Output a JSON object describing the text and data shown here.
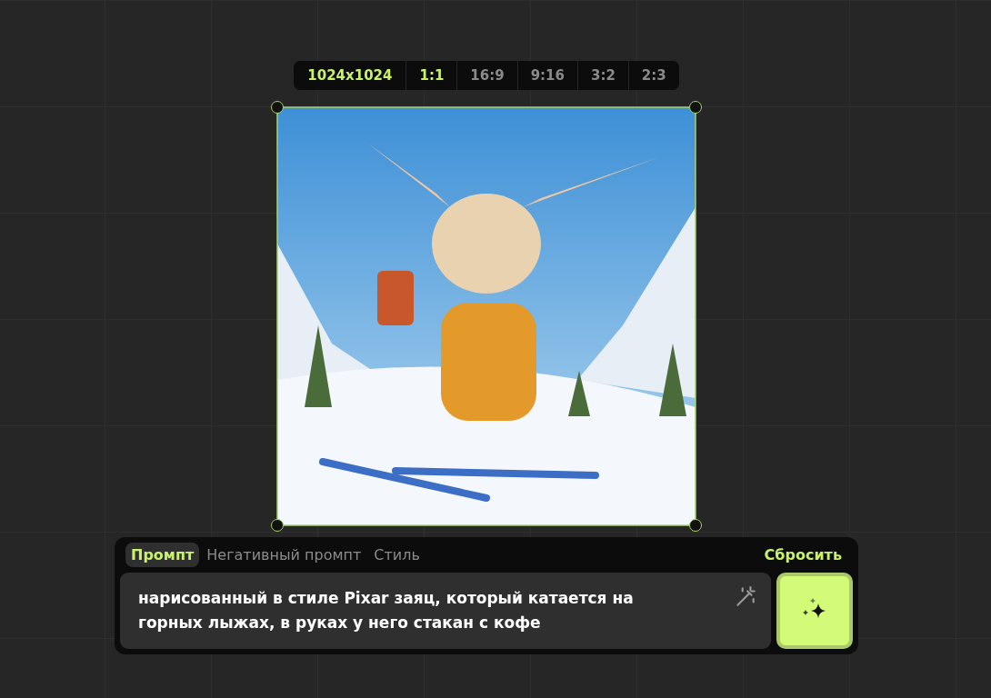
{
  "size_bar": {
    "size_label": "1024x1024",
    "ratios": [
      {
        "label": "1:1",
        "selected": true
      },
      {
        "label": "16:9",
        "selected": false
      },
      {
        "label": "9:16",
        "selected": false
      },
      {
        "label": "3:2",
        "selected": false
      },
      {
        "label": "2:3",
        "selected": false
      }
    ]
  },
  "image": {
    "selected": true
  },
  "prompt_panel": {
    "tabs": [
      {
        "label": "Промпт",
        "selected": true
      },
      {
        "label": "Негативный промпт",
        "selected": false
      },
      {
        "label": "Стиль",
        "selected": false
      }
    ],
    "reset": "Сбросить",
    "prompt": "нарисованный в стиле Pixar заяц, который катается на горных лыжах, в руках у него стакан с кофе"
  }
}
